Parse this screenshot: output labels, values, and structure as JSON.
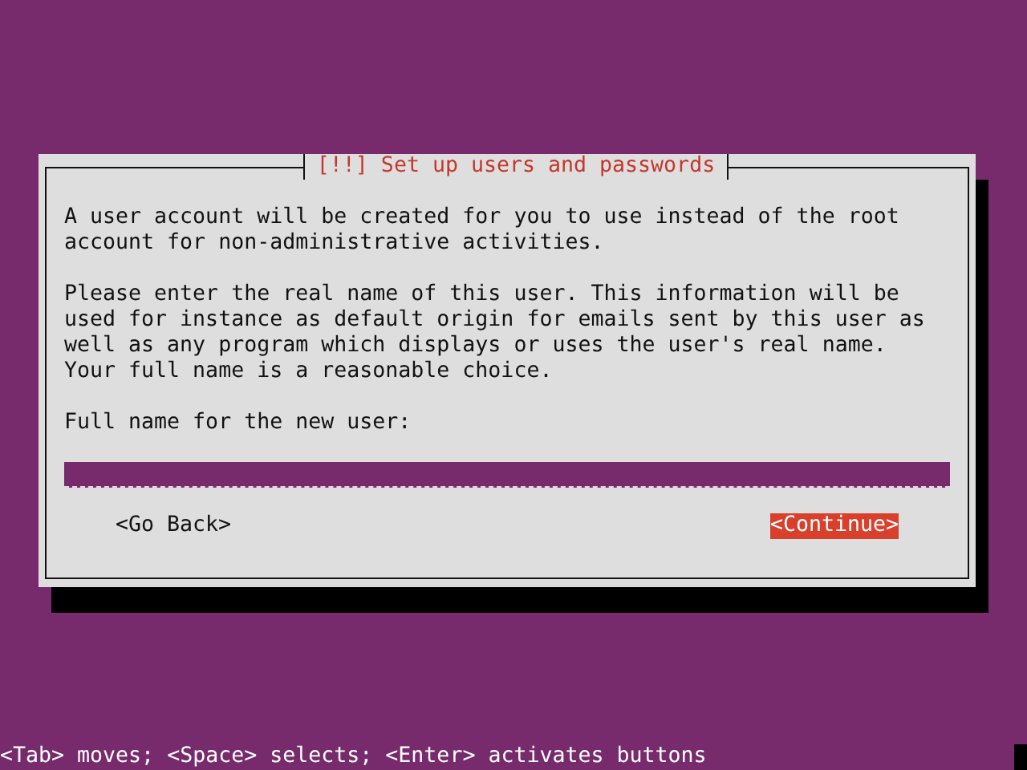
{
  "dialog": {
    "title": "[!!] Set up users and passwords",
    "paragraphs": [
      "A user account will be created for you to use instead of the root account for non-administrative activities.",
      "Please enter the real name of this user. This information will be used for instance as default origin for emails sent by this user as well as any program which displays or uses the user's real name. Your full name is a reasonable choice."
    ],
    "field": {
      "label": "Full name for the new user:"
    },
    "buttons": [
      {
        "label": "<Go Back>",
        "selected": false
      },
      {
        "label": "<Continue>",
        "selected": true
      }
    ]
  },
  "status_bar": "<Tab> moves; <Space> selects; <Enter> activates buttons"
}
